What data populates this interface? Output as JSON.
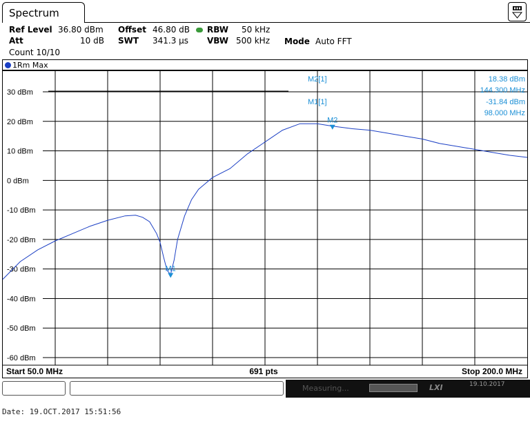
{
  "header": {
    "tab_title": "Spectrum",
    "ref_level_label": "Ref Level",
    "ref_level_value": "36.80 dBm",
    "offset_label": "Offset",
    "offset_value": "46.80 dB",
    "rbw_label": "RBW",
    "rbw_value": "50 kHz",
    "att_label": "Att",
    "att_value": "10 dB",
    "swt_label": "SWT",
    "swt_value": "341.3 µs",
    "vbw_label": "VBW",
    "vbw_value": "500 kHz",
    "mode_label": "Mode",
    "mode_value": "Auto FFT",
    "count_text": "Count 10/10"
  },
  "trace": {
    "label": "1Rm Max",
    "color": "#1b3fc4"
  },
  "markers": [
    {
      "name": "M2[1]",
      "level": "18.38 dBm",
      "freq": "144.300 MHz",
      "plot_label": "M2",
      "x_mhz": 144.3,
      "y_dbm": 18.38
    },
    {
      "name": "M1[1]",
      "level": "-31.84 dBm",
      "freq": "98.000 MHz",
      "plot_label": "M1",
      "x_mhz": 98.0,
      "y_dbm": -31.84
    }
  ],
  "footer": {
    "start": "Start 50.0 MHz",
    "points": "691 pts",
    "stop": "Stop 200.0 MHz"
  },
  "status": {
    "measuring": "Measuring...",
    "lxi": "LXI",
    "date_small": "19.10.2017"
  },
  "datestamp": "Date: 19.OCT.2017  15:51:56",
  "chart_data": {
    "type": "line",
    "xlim": [
      50,
      200
    ],
    "ylim": [
      -60,
      30
    ],
    "ytick_labels": [
      "30 dBm",
      "20 dBm",
      "10 dBm",
      "0 dBm",
      "-10 dBm",
      "-20 dBm",
      "-30 dBm",
      "-40 dBm",
      "-50 dBm",
      "-60 dBm"
    ],
    "grid": true,
    "series": [
      {
        "color": "#1b3fc4",
        "x": [
          50,
          55,
          60,
          65,
          70,
          75,
          80,
          85,
          88,
          90,
          92,
          94,
          95,
          96,
          97,
          98,
          99,
          100,
          102,
          104,
          106,
          108,
          110,
          115,
          120,
          125,
          130,
          135,
          140,
          144.3,
          150,
          155,
          160,
          165,
          170,
          175,
          180,
          185,
          190,
          195,
          200
        ],
        "y": [
          -33.5,
          -27.5,
          -23.5,
          -20.5,
          -18,
          -15.5,
          -13.5,
          -12,
          -11.8,
          -12.5,
          -14,
          -18,
          -21,
          -26,
          -30.5,
          -31.8,
          -27,
          -20,
          -12,
          -6.5,
          -3,
          -1,
          1,
          4,
          9,
          13,
          17,
          19.2,
          19.2,
          18.38,
          17.5,
          17,
          16,
          15,
          14,
          12.5,
          11.5,
          10.5,
          9.5,
          8.5,
          7.8
        ]
      }
    ]
  }
}
